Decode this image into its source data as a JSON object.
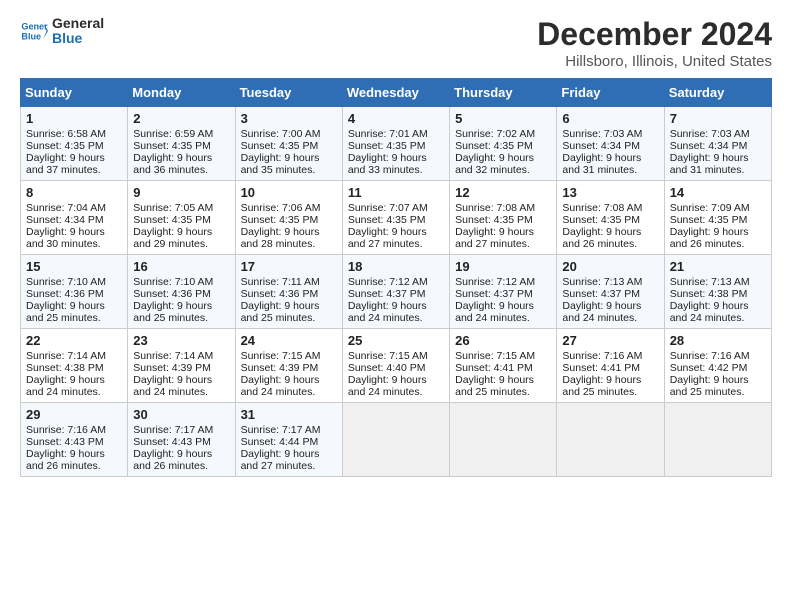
{
  "logo": {
    "line1": "General",
    "line2": "Blue"
  },
  "title": "December 2024",
  "subtitle": "Hillsboro, Illinois, United States",
  "days_header": [
    "Sunday",
    "Monday",
    "Tuesday",
    "Wednesday",
    "Thursday",
    "Friday",
    "Saturday"
  ],
  "weeks": [
    [
      {
        "day": "1",
        "lines": [
          "Sunrise: 6:58 AM",
          "Sunset: 4:35 PM",
          "Daylight: 9 hours",
          "and 37 minutes."
        ]
      },
      {
        "day": "2",
        "lines": [
          "Sunrise: 6:59 AM",
          "Sunset: 4:35 PM",
          "Daylight: 9 hours",
          "and 36 minutes."
        ]
      },
      {
        "day": "3",
        "lines": [
          "Sunrise: 7:00 AM",
          "Sunset: 4:35 PM",
          "Daylight: 9 hours",
          "and 35 minutes."
        ]
      },
      {
        "day": "4",
        "lines": [
          "Sunrise: 7:01 AM",
          "Sunset: 4:35 PM",
          "Daylight: 9 hours",
          "and 33 minutes."
        ]
      },
      {
        "day": "5",
        "lines": [
          "Sunrise: 7:02 AM",
          "Sunset: 4:35 PM",
          "Daylight: 9 hours",
          "and 32 minutes."
        ]
      },
      {
        "day": "6",
        "lines": [
          "Sunrise: 7:03 AM",
          "Sunset: 4:34 PM",
          "Daylight: 9 hours",
          "and 31 minutes."
        ]
      },
      {
        "day": "7",
        "lines": [
          "Sunrise: 7:03 AM",
          "Sunset: 4:34 PM",
          "Daylight: 9 hours",
          "and 31 minutes."
        ]
      }
    ],
    [
      {
        "day": "8",
        "lines": [
          "Sunrise: 7:04 AM",
          "Sunset: 4:34 PM",
          "Daylight: 9 hours",
          "and 30 minutes."
        ]
      },
      {
        "day": "9",
        "lines": [
          "Sunrise: 7:05 AM",
          "Sunset: 4:35 PM",
          "Daylight: 9 hours",
          "and 29 minutes."
        ]
      },
      {
        "day": "10",
        "lines": [
          "Sunrise: 7:06 AM",
          "Sunset: 4:35 PM",
          "Daylight: 9 hours",
          "and 28 minutes."
        ]
      },
      {
        "day": "11",
        "lines": [
          "Sunrise: 7:07 AM",
          "Sunset: 4:35 PM",
          "Daylight: 9 hours",
          "and 27 minutes."
        ]
      },
      {
        "day": "12",
        "lines": [
          "Sunrise: 7:08 AM",
          "Sunset: 4:35 PM",
          "Daylight: 9 hours",
          "and 27 minutes."
        ]
      },
      {
        "day": "13",
        "lines": [
          "Sunrise: 7:08 AM",
          "Sunset: 4:35 PM",
          "Daylight: 9 hours",
          "and 26 minutes."
        ]
      },
      {
        "day": "14",
        "lines": [
          "Sunrise: 7:09 AM",
          "Sunset: 4:35 PM",
          "Daylight: 9 hours",
          "and 26 minutes."
        ]
      }
    ],
    [
      {
        "day": "15",
        "lines": [
          "Sunrise: 7:10 AM",
          "Sunset: 4:36 PM",
          "Daylight: 9 hours",
          "and 25 minutes."
        ]
      },
      {
        "day": "16",
        "lines": [
          "Sunrise: 7:10 AM",
          "Sunset: 4:36 PM",
          "Daylight: 9 hours",
          "and 25 minutes."
        ]
      },
      {
        "day": "17",
        "lines": [
          "Sunrise: 7:11 AM",
          "Sunset: 4:36 PM",
          "Daylight: 9 hours",
          "and 25 minutes."
        ]
      },
      {
        "day": "18",
        "lines": [
          "Sunrise: 7:12 AM",
          "Sunset: 4:37 PM",
          "Daylight: 9 hours",
          "and 24 minutes."
        ]
      },
      {
        "day": "19",
        "lines": [
          "Sunrise: 7:12 AM",
          "Sunset: 4:37 PM",
          "Daylight: 9 hours",
          "and 24 minutes."
        ]
      },
      {
        "day": "20",
        "lines": [
          "Sunrise: 7:13 AM",
          "Sunset: 4:37 PM",
          "Daylight: 9 hours",
          "and 24 minutes."
        ]
      },
      {
        "day": "21",
        "lines": [
          "Sunrise: 7:13 AM",
          "Sunset: 4:38 PM",
          "Daylight: 9 hours",
          "and 24 minutes."
        ]
      }
    ],
    [
      {
        "day": "22",
        "lines": [
          "Sunrise: 7:14 AM",
          "Sunset: 4:38 PM",
          "Daylight: 9 hours",
          "and 24 minutes."
        ]
      },
      {
        "day": "23",
        "lines": [
          "Sunrise: 7:14 AM",
          "Sunset: 4:39 PM",
          "Daylight: 9 hours",
          "and 24 minutes."
        ]
      },
      {
        "day": "24",
        "lines": [
          "Sunrise: 7:15 AM",
          "Sunset: 4:39 PM",
          "Daylight: 9 hours",
          "and 24 minutes."
        ]
      },
      {
        "day": "25",
        "lines": [
          "Sunrise: 7:15 AM",
          "Sunset: 4:40 PM",
          "Daylight: 9 hours",
          "and 24 minutes."
        ]
      },
      {
        "day": "26",
        "lines": [
          "Sunrise: 7:15 AM",
          "Sunset: 4:41 PM",
          "Daylight: 9 hours",
          "and 25 minutes."
        ]
      },
      {
        "day": "27",
        "lines": [
          "Sunrise: 7:16 AM",
          "Sunset: 4:41 PM",
          "Daylight: 9 hours",
          "and 25 minutes."
        ]
      },
      {
        "day": "28",
        "lines": [
          "Sunrise: 7:16 AM",
          "Sunset: 4:42 PM",
          "Daylight: 9 hours",
          "and 25 minutes."
        ]
      }
    ],
    [
      {
        "day": "29",
        "lines": [
          "Sunrise: 7:16 AM",
          "Sunset: 4:43 PM",
          "Daylight: 9 hours",
          "and 26 minutes."
        ]
      },
      {
        "day": "30",
        "lines": [
          "Sunrise: 7:17 AM",
          "Sunset: 4:43 PM",
          "Daylight: 9 hours",
          "and 26 minutes."
        ]
      },
      {
        "day": "31",
        "lines": [
          "Sunrise: 7:17 AM",
          "Sunset: 4:44 PM",
          "Daylight: 9 hours",
          "and 27 minutes."
        ]
      },
      null,
      null,
      null,
      null
    ]
  ]
}
